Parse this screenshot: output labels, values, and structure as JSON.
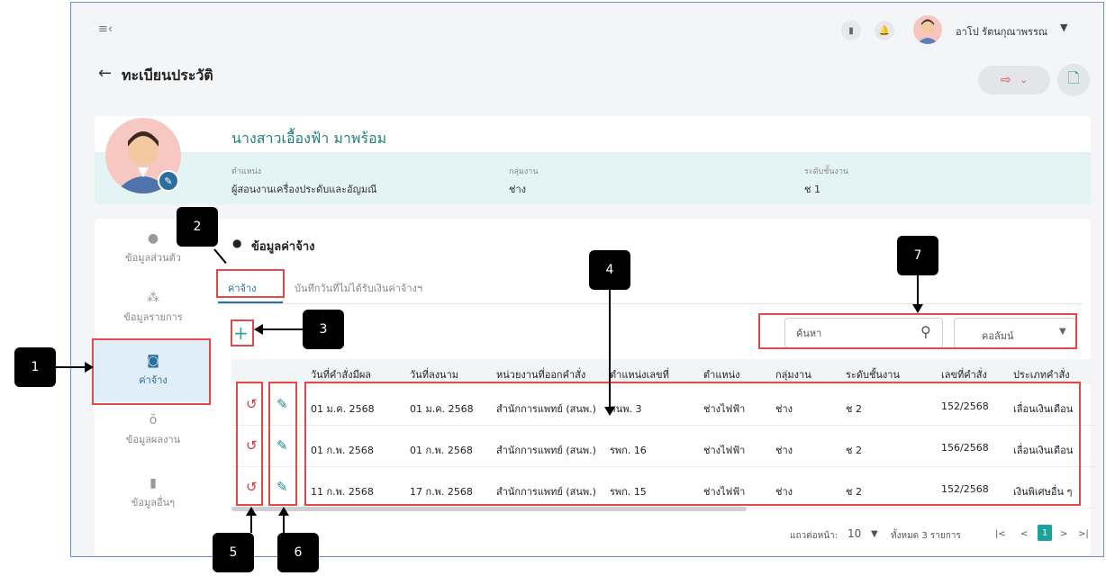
{
  "header": {
    "menu_icon": "≡‹",
    "user_name": "อาโป รัตนกุณาพรรณ",
    "page_title": "ทะเบียนประวัติ"
  },
  "profile": {
    "name": "นางสาวเอื้องฟ้า มาพร้อม",
    "position_label": "ตำแหน่ง",
    "position_value": "ผู้สอนงานเครื่องประดับและอัญมณี",
    "group_label": "กลุ่มงาน",
    "group_value": "ช่าง",
    "level_label": "ระดับชั้นงาน",
    "level_value": "ช 1"
  },
  "sidebar": {
    "items": [
      {
        "label": "ข้อมูลส่วนตัว",
        "icon": "person-icon"
      },
      {
        "label": "ข้อมูลรายการ",
        "icon": "org-icon"
      },
      {
        "label": "ค่าจ้าง",
        "icon": "money-icon"
      },
      {
        "label": "ข้อมูลผลงาน",
        "icon": "award-icon"
      },
      {
        "label": "ข้อมูลอื่นๆ",
        "icon": "bookmark-icon"
      }
    ]
  },
  "section": {
    "title": "ข้อมูลค่าจ้าง",
    "tabs": [
      "ค่าจ้าง",
      "บันทึกวันที่ไม่ได้รับเงินค่าจ้างฯ"
    ],
    "search_placeholder": "ค้นหา",
    "column_select": "คอลัมน์"
  },
  "table": {
    "headers": [
      "วันที่คำสั่งมีผล",
      "วันที่ลงนาม",
      "หน่วยงานที่ออกคำสั่ง",
      "ตำแหน่งเลขที่",
      "ตำแหน่ง",
      "กลุ่มงาน",
      "ระดับชั้นงาน",
      "เลขที่คำสั่ง",
      "ประเภทคำสั่ง"
    ],
    "rows": [
      [
        "01 ม.ค. 2568",
        "01 ม.ค. 2568",
        "สำนักการแพทย์ (สนพ.)",
        "สนพ. 3",
        "ช่างไฟฟ้า",
        "ช่าง",
        "ช 2",
        "152/2568",
        "เลื่อนเงินเดือน"
      ],
      [
        "01 ก.พ. 2568",
        "01 ก.พ. 2568",
        "สำนักการแพทย์ (สนพ.)",
        "รพก. 16",
        "ช่างไฟฟ้า",
        "ช่าง",
        "ช 2",
        "156/2568",
        "เลื่อนเงินเดือน"
      ],
      [
        "11 ก.พ. 2568",
        "17 ก.พ. 2568",
        "สำนักการแพทย์ (สนพ.)",
        "รพก. 15",
        "ช่างไฟฟ้า",
        "ช่าง",
        "ช 2",
        "152/2568",
        "เงินพิเศษอื่น ๆ"
      ]
    ]
  },
  "pagination": {
    "rows_per_page_label": "แถวต่อหน้า:",
    "rows_per_page": "10",
    "total_label": "ทั้งหมด 3 รายการ",
    "current_page": "1"
  },
  "callouts": [
    "1",
    "2",
    "3",
    "4",
    "5",
    "6",
    "7"
  ],
  "colors": {
    "accent": "#2a6f9e",
    "teal": "#1f8a86",
    "red": "#e04a4a"
  }
}
